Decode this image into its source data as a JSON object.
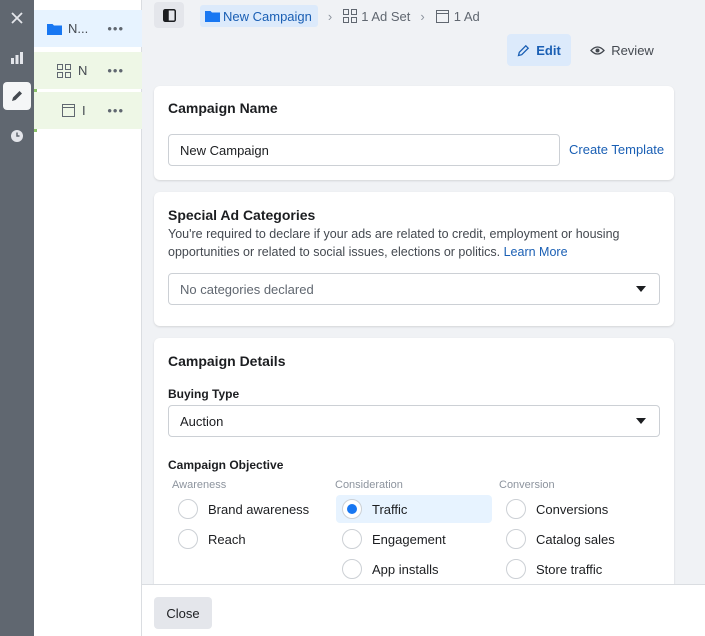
{
  "tree": {
    "campaign_label": "N...",
    "adset_label": "N",
    "ad_label": "I",
    "more_glyph": "•••"
  },
  "breadcrumb": {
    "campaign": "New Campaign",
    "adset": "1 Ad Set",
    "ad": "1 Ad"
  },
  "modes": {
    "edit": "Edit",
    "review": "Review"
  },
  "campaign_name": {
    "title": "Campaign Name",
    "value": "New Campaign",
    "create_template": "Create Template"
  },
  "special_ad_categories": {
    "title": "Special Ad Categories",
    "description": "You're required to declare if your ads are related to credit, employment or housing opportunities or related to social issues, elections or politics.",
    "learn_more": "Learn More",
    "placeholder": "No categories declared"
  },
  "campaign_details": {
    "title": "Campaign Details",
    "buying_type_label": "Buying Type",
    "buying_type_value": "Auction",
    "objective_label": "Campaign Objective",
    "columns": [
      {
        "heading": "Awareness",
        "options": [
          "Brand awareness",
          "Reach"
        ]
      },
      {
        "heading": "Consideration",
        "options": [
          "Traffic",
          "Engagement",
          "App installs"
        ]
      },
      {
        "heading": "Conversion",
        "options": [
          "Conversions",
          "Catalog sales",
          "Store traffic"
        ]
      }
    ],
    "selected_option": "Traffic"
  },
  "footer": {
    "close": "Close"
  },
  "colors": {
    "accent": "#1877f2",
    "link": "#1a5fb4",
    "rail": "#606770"
  }
}
